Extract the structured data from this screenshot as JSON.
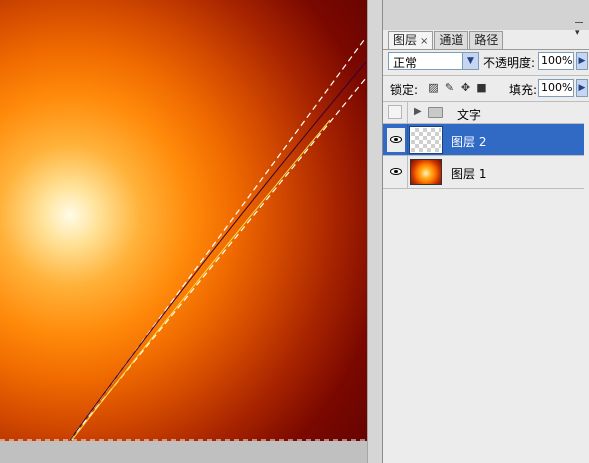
{
  "panel": {
    "tabs": [
      {
        "label": "图层",
        "close": "×",
        "active": true
      },
      {
        "label": "通道",
        "active": false
      },
      {
        "label": "路径",
        "active": false
      }
    ],
    "blend_mode": "正常",
    "opacity_label": "不透明度:",
    "opacity_value": "100%",
    "lock_label": "锁定:",
    "fill_label": "填充:",
    "fill_value": "100%",
    "layers": [
      {
        "name": "文字",
        "type": "group",
        "visible": false,
        "selected": false
      },
      {
        "name": "图层 2",
        "type": "layer",
        "visible": true,
        "selected": true
      },
      {
        "name": "图层 1",
        "type": "layer",
        "visible": true,
        "selected": false
      }
    ]
  },
  "icons": [
    "close-icon",
    "dropdown-arrow-icon",
    "lock-transparent-icon",
    "lock-brush-icon",
    "lock-move-icon",
    "lock-all-icon",
    "eye-icon",
    "expand-arrow-icon",
    "folder-icon",
    "panel-menu-icon"
  ],
  "colors": {
    "selection_blue": "#316ac5",
    "panel_bg": "#ececec",
    "canvas_dark": "#650300",
    "canvas_glow": "#fffbe8"
  }
}
